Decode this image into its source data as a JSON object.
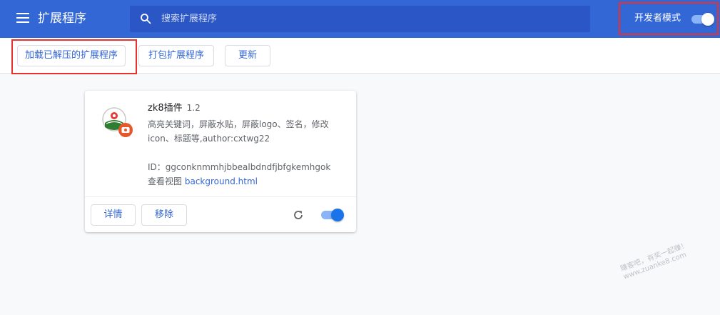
{
  "header": {
    "title": "扩展程序",
    "search_placeholder": "搜索扩展程序",
    "dev_mode_label": "开发者模式",
    "dev_mode_on": true
  },
  "toolbar": {
    "load_unpacked": "加载已解压的扩展程序",
    "pack": "打包扩展程序",
    "update": "更新"
  },
  "extension": {
    "name": "zk8插件",
    "version": "1.2",
    "description": "高亮关键词，屏蔽水贴，屏蔽logo、签名，修改icon、标题等,author:cxtwg22",
    "id_text": "ID：ggconknmmhjbbealbdndfjbfgkemhgok",
    "views_label": "查看视图",
    "views_link": "background.html",
    "details_button": "详情",
    "remove_button": "移除",
    "enabled": true
  },
  "watermark": {
    "line1": "赚客吧，有奖一起赚！",
    "line2": "www.zuanke8.com"
  },
  "icons": {
    "menu": "hamburger-menu-icon",
    "search": "search-icon",
    "reload": "reload-icon",
    "extension": "extension-logo-icon"
  },
  "colors": {
    "header_bg": "#3367d6",
    "search_bg": "#2a56c6",
    "accent": "#3367d6",
    "highlight_box": "#e8312c",
    "toggle_knob_on": "#1a73e8",
    "toggle_track_on": "#8ab4f8"
  }
}
